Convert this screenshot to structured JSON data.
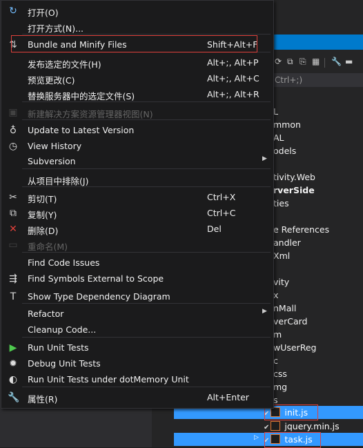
{
  "menu": {
    "items": [
      {
        "label": "打开(O)",
        "icon": "open-icon"
      },
      {
        "label": "打开方式(N)...",
        "icon": ""
      },
      {
        "label": "Bundle and Minify Files",
        "shortcut": "Shift+Alt+F",
        "icon": "bundle-icon"
      },
      {
        "label": "发布选定的文件(H)",
        "shortcut": "Alt+;, Alt+P"
      },
      {
        "label": "预览更改(C)",
        "shortcut": "Alt+;, Alt+C"
      },
      {
        "label": "替换服务器中的选定文件(S)",
        "shortcut": "Alt+;, Alt+R"
      },
      {
        "label": "新建解决方案资源管理器视图(N)",
        "icon": "new-view-icon",
        "disabled": true
      },
      {
        "label": "Update to Latest Version",
        "icon": "update-icon"
      },
      {
        "label": "View History",
        "icon": "history-icon"
      },
      {
        "label": "Subversion",
        "submenu": true
      },
      {
        "label": "从项目中排除(J)"
      },
      {
        "label": "剪切(T)",
        "shortcut": "Ctrl+X",
        "icon": "cut-icon"
      },
      {
        "label": "复制(Y)",
        "shortcut": "Ctrl+C",
        "icon": "copy-icon"
      },
      {
        "label": "删除(D)",
        "shortcut": "Del",
        "icon": "delete-icon"
      },
      {
        "label": "重命名(M)",
        "icon": "rename-icon",
        "disabled": true
      },
      {
        "label": "Find Code Issues"
      },
      {
        "label": "Find Symbols External to Scope",
        "icon": "find-symbols-icon"
      },
      {
        "label": "Show Type Dependency Diagram",
        "icon": "type-diagram-icon"
      },
      {
        "label": "Refactor",
        "submenu": true
      },
      {
        "label": "Cleanup Code..."
      },
      {
        "label": "Run Unit Tests",
        "icon": "run-tests-icon"
      },
      {
        "label": "Debug Unit Tests",
        "icon": "debug-tests-icon"
      },
      {
        "label": "Run Unit Tests under dotMemory Unit",
        "icon": "dotmemory-icon"
      },
      {
        "label": "属性(R)",
        "shortcut": "Alt+Enter",
        "icon": "wrench-icon"
      }
    ]
  },
  "explorer": {
    "search_placeholder": "Ctrl+;)",
    "tree": [
      {
        "text": "L"
      },
      {
        "text": "mmon"
      },
      {
        "text": "AL"
      },
      {
        "text": "odels"
      },
      {
        "text": "tivity.Web"
      },
      {
        "text": "rverSide",
        "bold": true
      },
      {
        "text": "ties"
      },
      {
        "text": "e References"
      },
      {
        "text": "andler"
      },
      {
        "text": "Xml"
      },
      {
        "text": "vity"
      },
      {
        "text": "x"
      },
      {
        "text": "nMall"
      },
      {
        "text": "verCard"
      },
      {
        "text": "m"
      },
      {
        "text": "wUserReg"
      },
      {
        "text": "c"
      },
      {
        "text": "css"
      },
      {
        "text": "mg"
      },
      {
        "text": "s"
      }
    ],
    "files": [
      {
        "name": "init.js",
        "selected": true
      },
      {
        "name": "jquery.min.js",
        "selected": false
      },
      {
        "name": "task.js",
        "selected": true
      }
    ]
  },
  "colors": {
    "accent": "#007acc",
    "selection": "#3399ff",
    "highlight_box": "#e0413b"
  }
}
